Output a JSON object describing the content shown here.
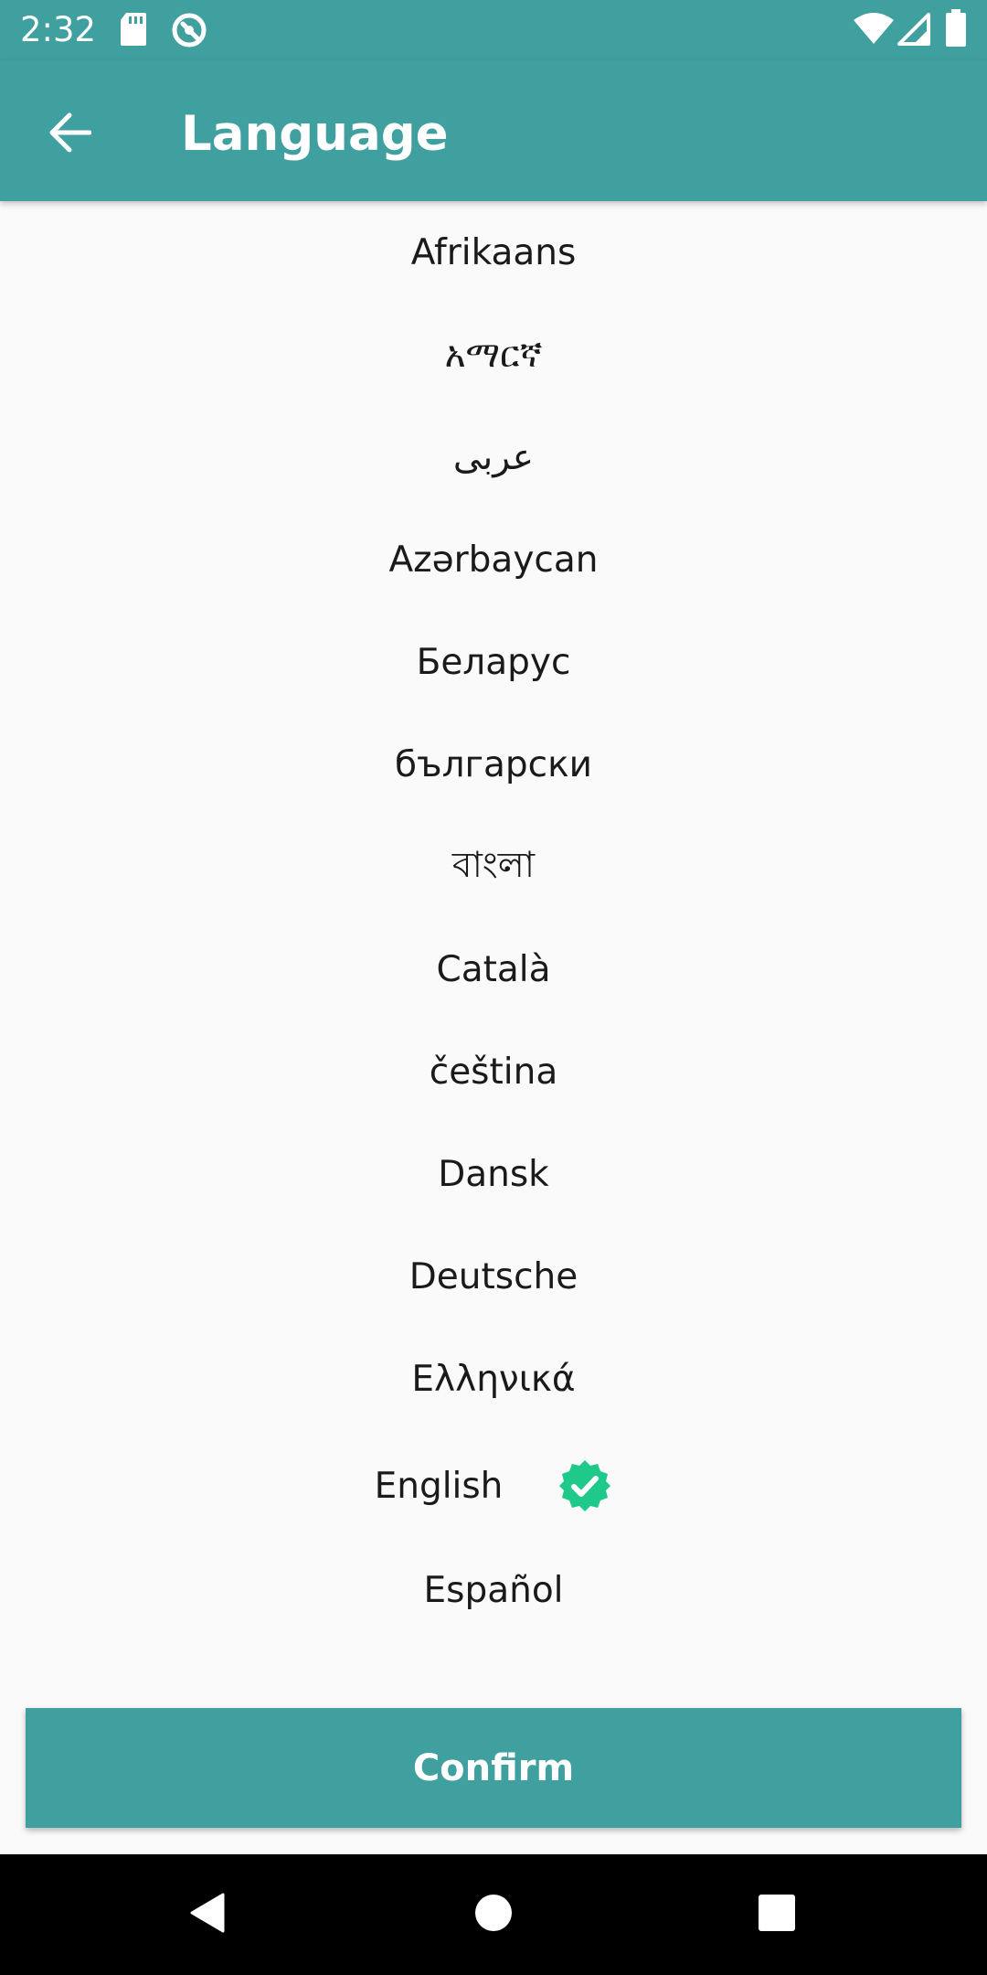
{
  "status_bar": {
    "time": "2:32",
    "icons": [
      "sd-card-icon",
      "sync-icon",
      "wifi-icon",
      "signal-icon",
      "battery-icon"
    ]
  },
  "app_bar": {
    "back_icon": "arrow-left-icon",
    "title": "Language"
  },
  "languages": [
    {
      "label": "Afrikaans",
      "selected": false
    },
    {
      "label": "አማርኛ",
      "selected": false
    },
    {
      "label": "عربى",
      "selected": false
    },
    {
      "label": "Azərbaycan",
      "selected": false
    },
    {
      "label": "Беларус",
      "selected": false
    },
    {
      "label": "български",
      "selected": false
    },
    {
      "label": "বাংলা",
      "selected": false
    },
    {
      "label": "Català",
      "selected": false
    },
    {
      "label": "čeština",
      "selected": false
    },
    {
      "label": "Dansk",
      "selected": false
    },
    {
      "label": "Deutsche",
      "selected": false
    },
    {
      "label": "Ελληνικά",
      "selected": false
    },
    {
      "label": "English",
      "selected": true
    },
    {
      "label": "Español",
      "selected": false
    }
  ],
  "selected_icon": "verified-check-icon",
  "confirm_label": "Confirm",
  "colors": {
    "primary": "#409f9f",
    "check": "#1ec98a",
    "background": "#fafafa"
  },
  "nav_bar": {
    "icons": [
      "back-triangle-icon",
      "home-circle-icon",
      "recents-square-icon"
    ]
  }
}
